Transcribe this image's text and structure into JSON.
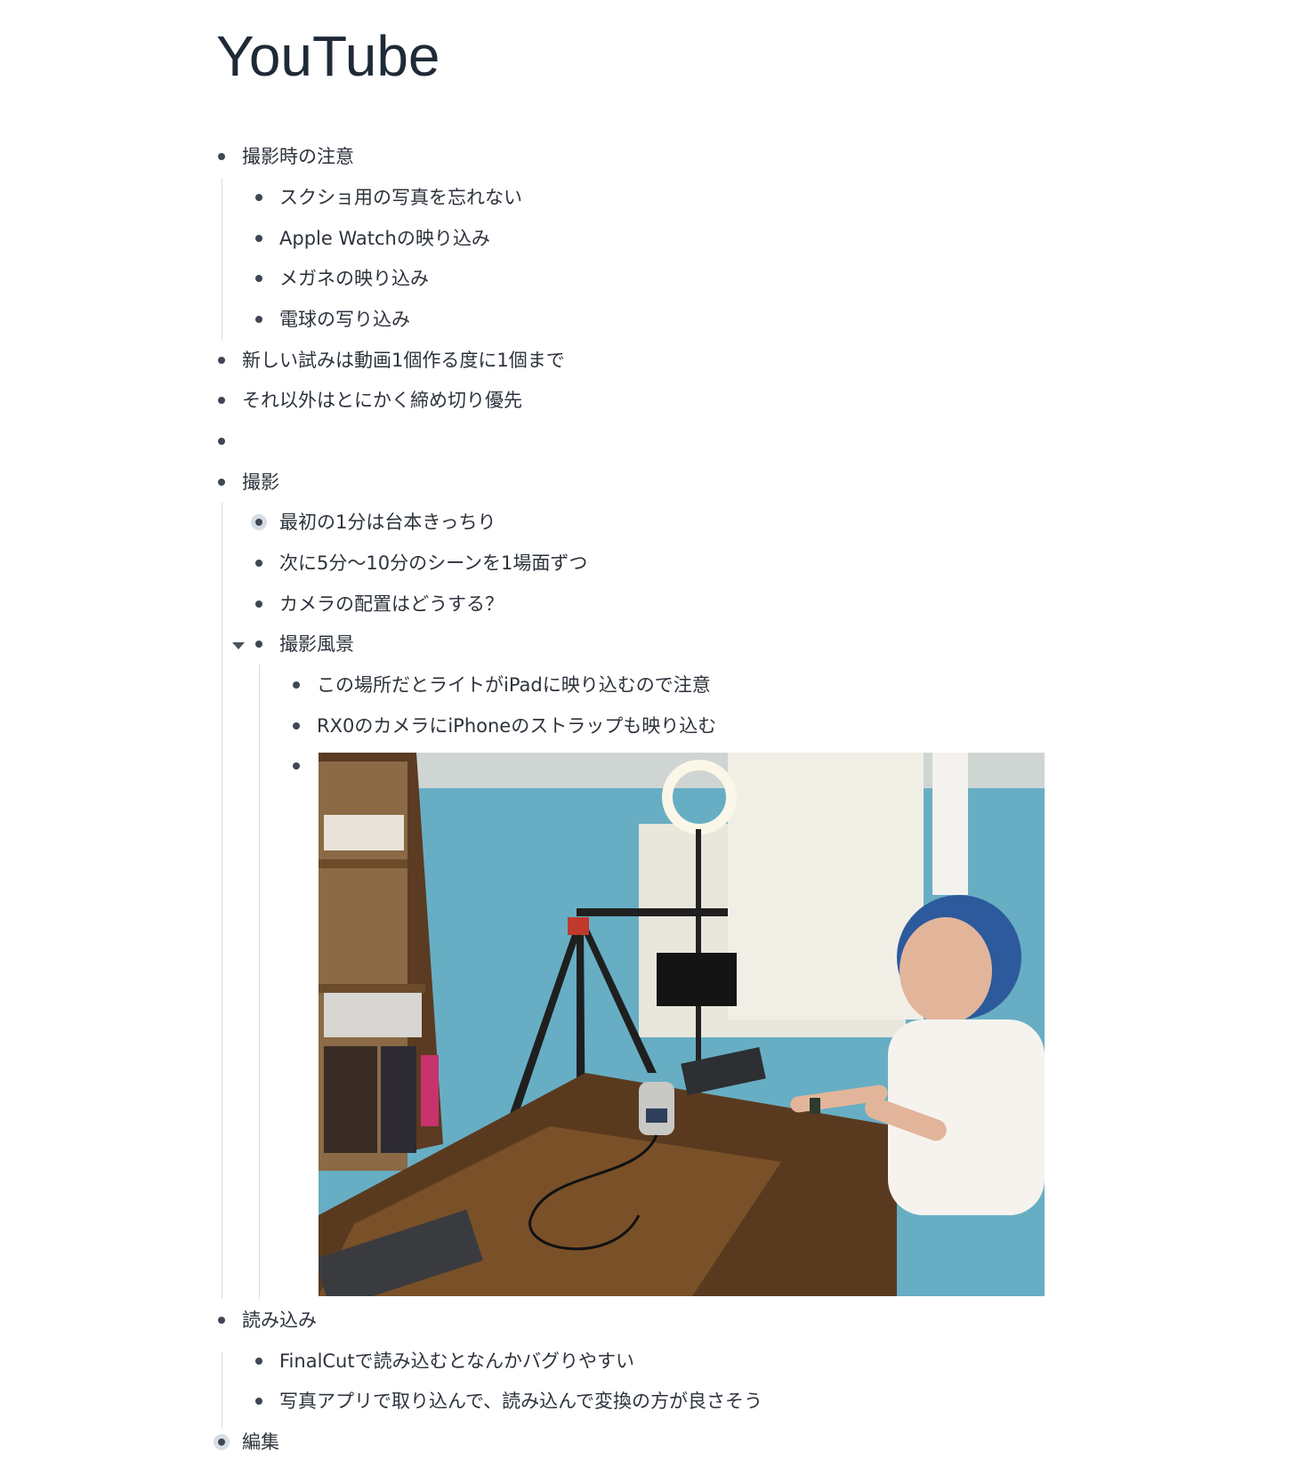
{
  "page": {
    "title": "YouTube"
  },
  "outline": {
    "filming_notes": {
      "label": "撮影時の注意",
      "children": [
        "スクショ用の写真を忘れない",
        "Apple Watchの映り込み",
        "メガネの映り込み",
        "電球の写り込み"
      ]
    },
    "new_trials": "新しい試みは動画1個作る度に1個まで",
    "deadline": "それ以外はとにかく締め切り優先",
    "empty_item": "",
    "filming": {
      "label": "撮影",
      "children": [
        "最初の1分は台本きっちり",
        "次に5分〜10分のシーンを1場面ずつ",
        "カメラの配置はどうする？"
      ],
      "scene": {
        "label": "撮影風景",
        "children": [
          "この場所だとライトがiPadに映り込むので注意",
          "RX0のカメラにiPhoneのストラップも映り込む"
        ],
        "photo_icon": "photo-image"
      }
    },
    "import": {
      "label": "読み込み",
      "children": [
        "FinalCutで読み込むとなんかバグりやすい",
        "写真アプリで取り込んで、読み込んで変換の方が良さそう"
      ]
    },
    "editing": {
      "label": "編集"
    }
  },
  "colors": {
    "text": "#2d333c",
    "bullet": "#3f4753",
    "bullet_ring": "#d7dde5",
    "guide_line": "#d9dde3"
  }
}
